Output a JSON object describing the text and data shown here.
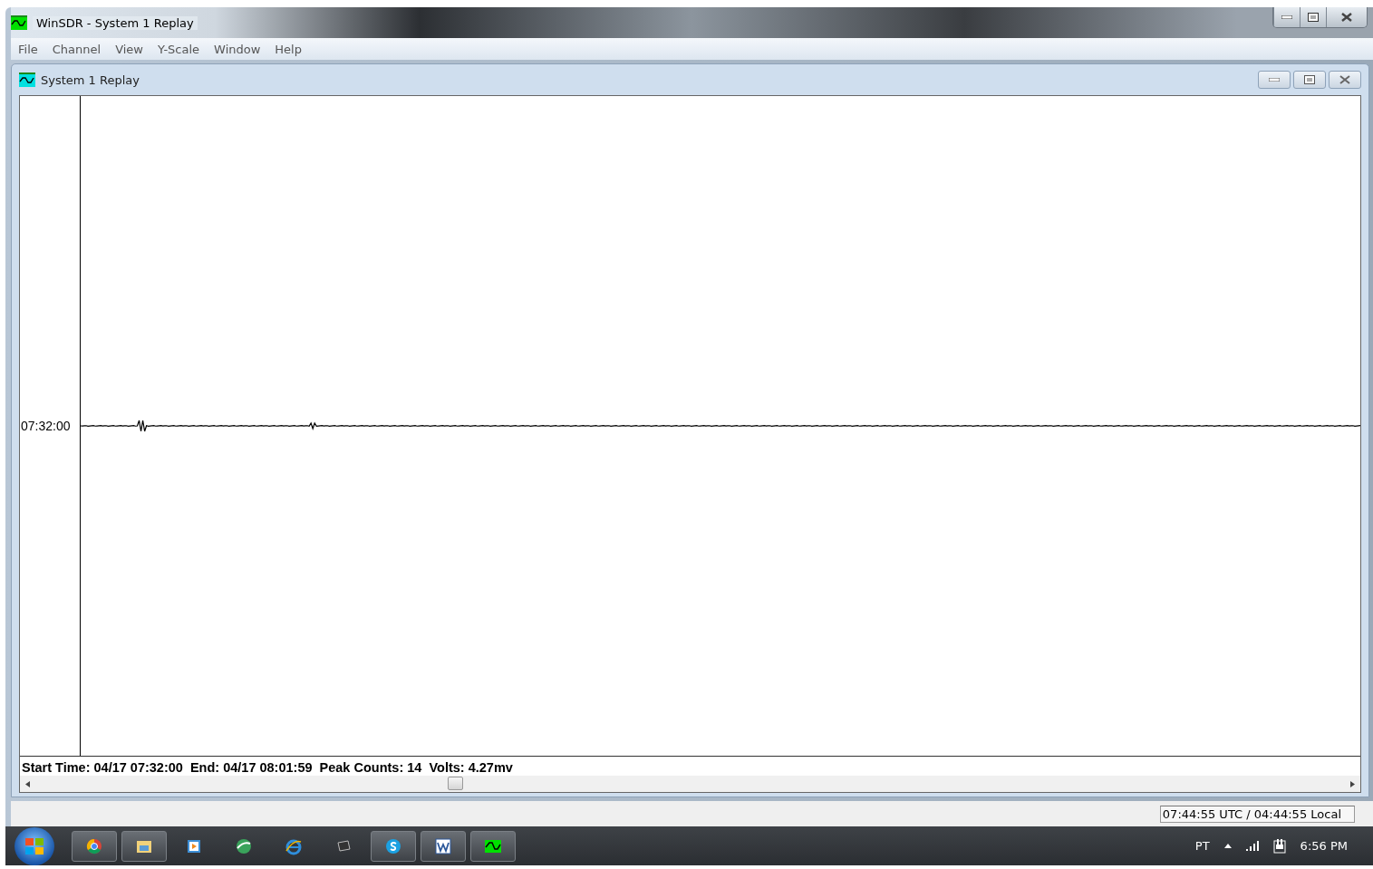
{
  "window": {
    "title": "WinSDR - System 1 Replay"
  },
  "menu": [
    "File",
    "Channel",
    "View",
    "Y-Scale",
    "Window",
    "Help"
  ],
  "child_window": {
    "title": "System 1 Replay"
  },
  "trace": {
    "time_label": "07:32:00"
  },
  "info_line": "Start Time: 04/17 07:32:00  End: 04/17 08:01:59  Peak Counts: 14  Volts: 4.27mv",
  "status_bar": {
    "clock": "07:44:55 UTC / 04:44:55 Local"
  },
  "taskbar": {
    "items": [
      {
        "kind": "chrome",
        "running": true
      },
      {
        "kind": "folder",
        "running": true
      },
      {
        "kind": "media",
        "running": false
      },
      {
        "kind": "globe",
        "running": false
      },
      {
        "kind": "ie",
        "running": false
      },
      {
        "kind": "device",
        "running": false
      },
      {
        "kind": "skype",
        "running": true
      },
      {
        "kind": "word",
        "running": true
      },
      {
        "kind": "wave",
        "running": true
      }
    ],
    "language": "PT",
    "time": "6:56 PM"
  }
}
